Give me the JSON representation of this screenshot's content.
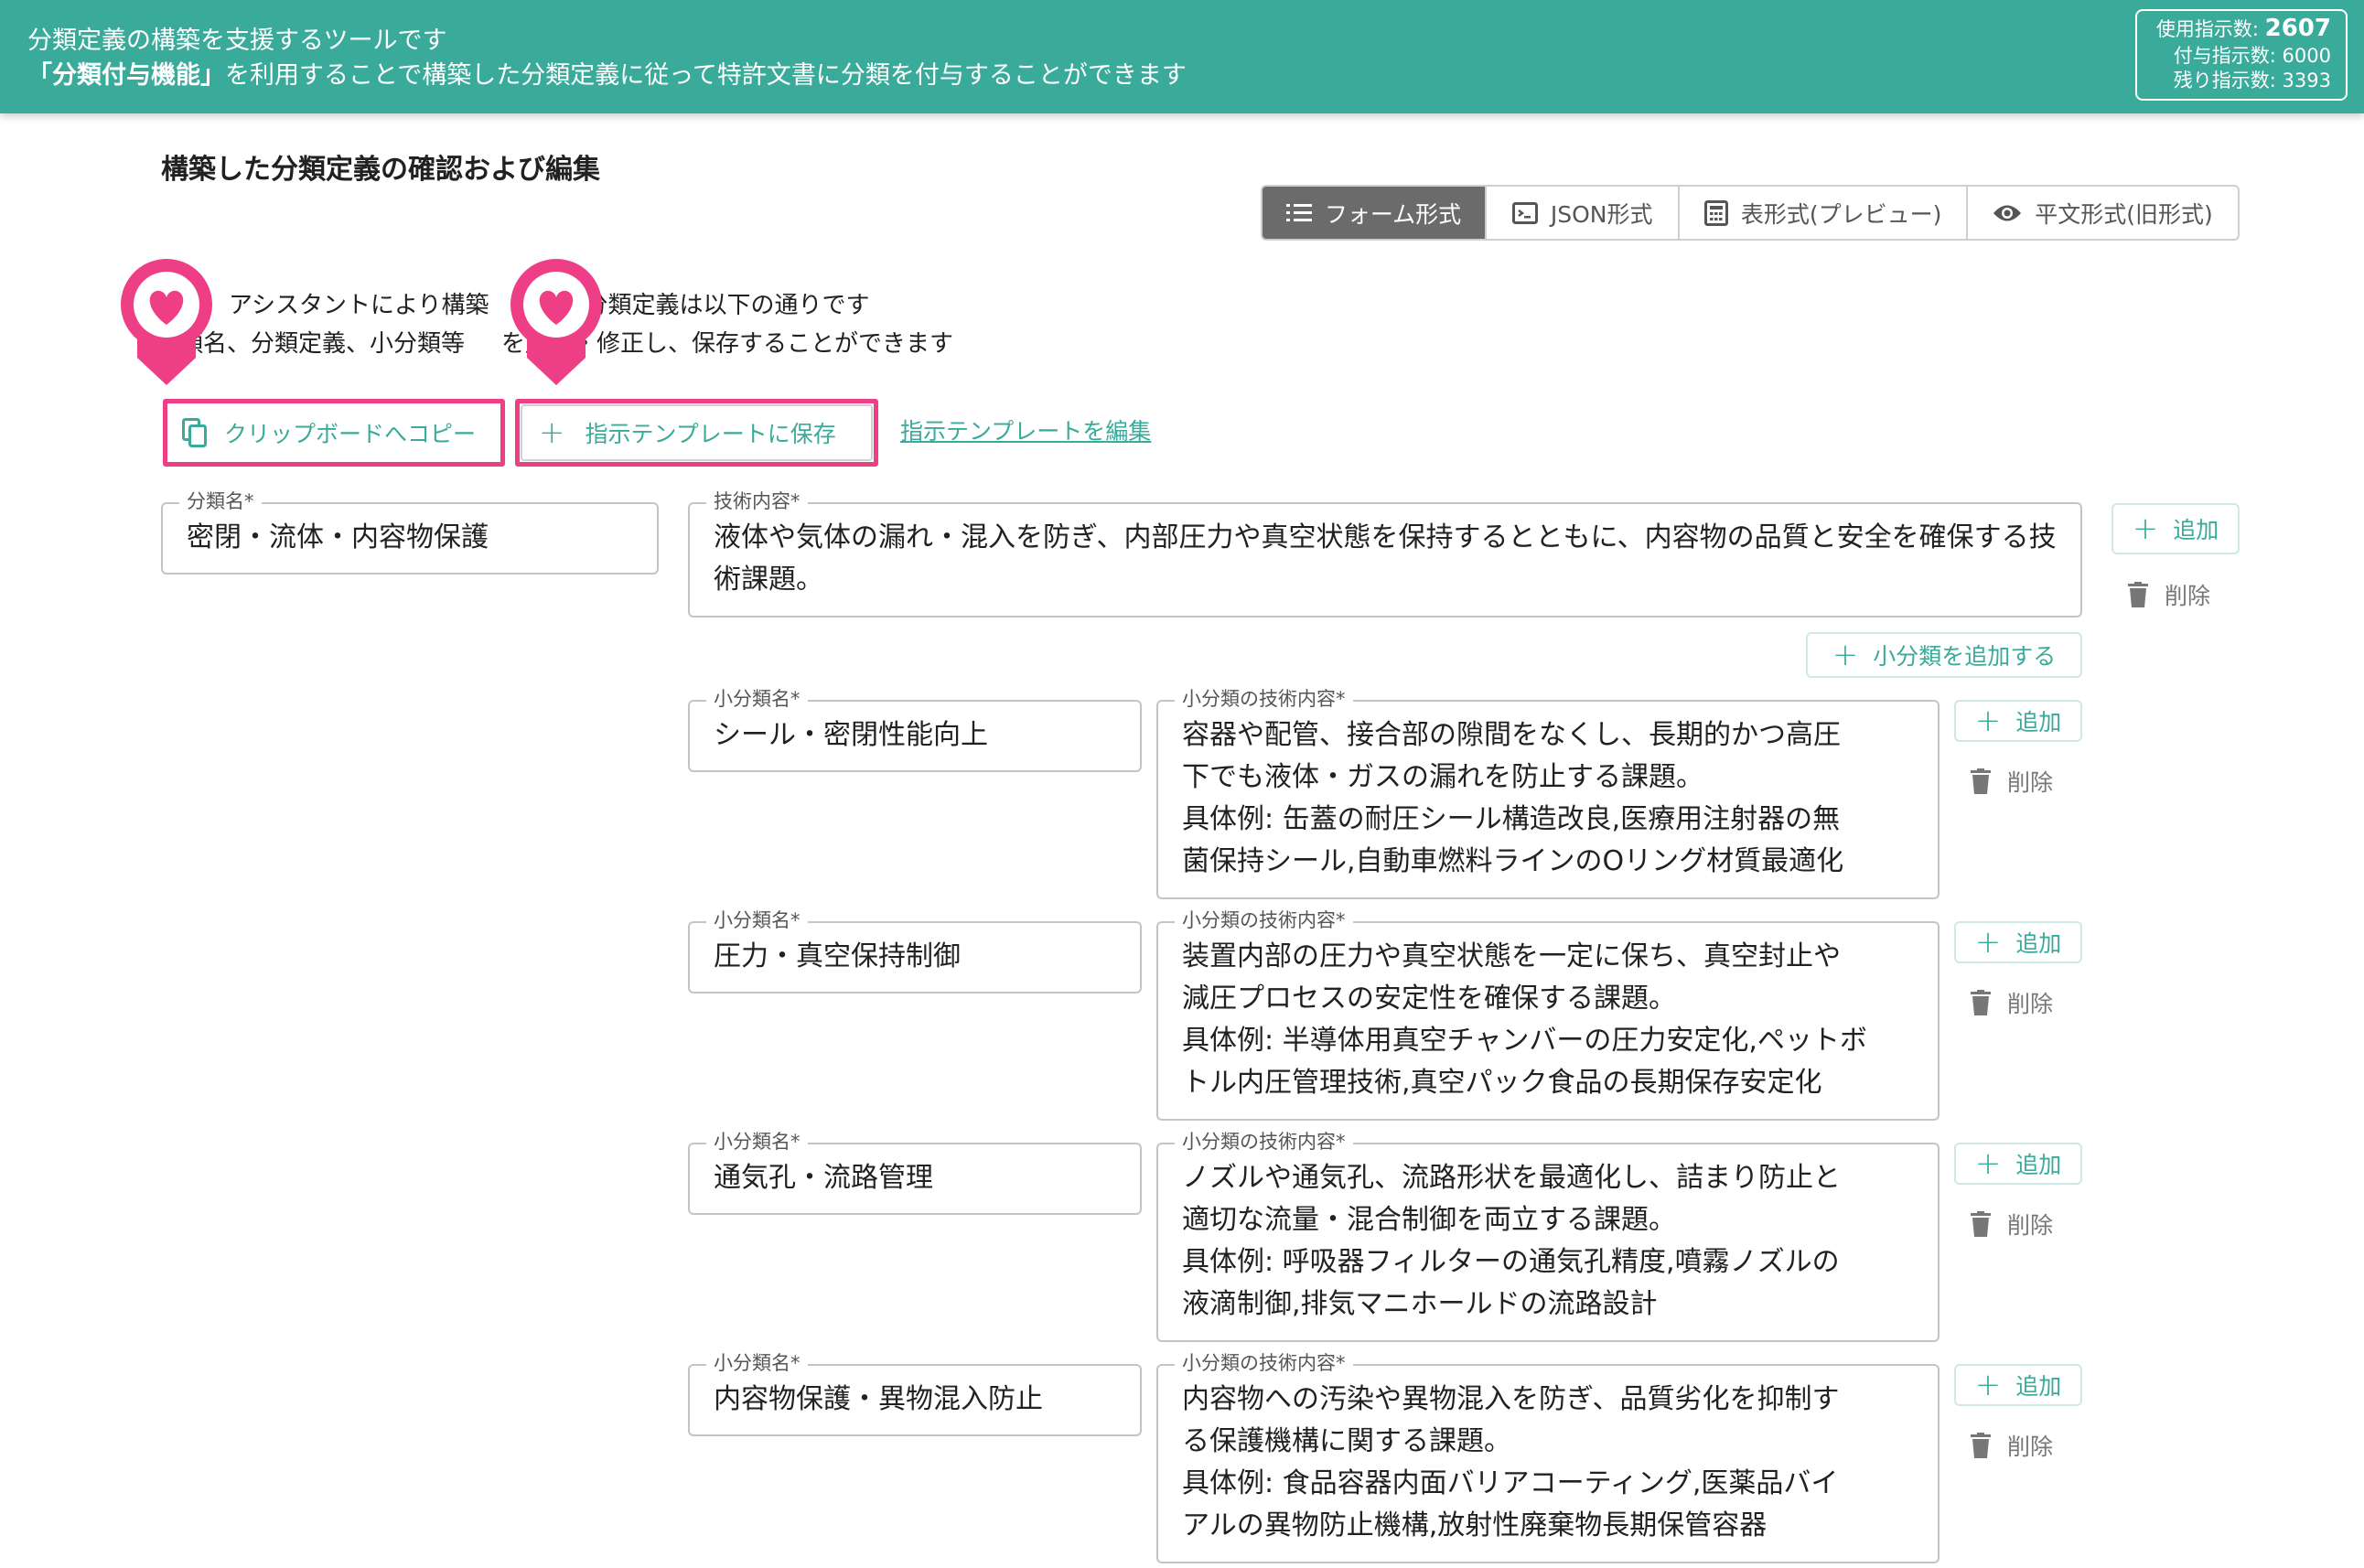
{
  "header": {
    "line1": "分類定義の構築を支援するツールです",
    "line2_bold": "「分類付与機能」",
    "line2_rest": "を利用することで構築した分類定義に従って特許文書に分類を付与することができます",
    "usage_label": "使用指示数:",
    "usage_value": "2607",
    "granted_label": "付与指示数:",
    "granted_value": "6000",
    "remaining_label": "残り指示数:",
    "remaining_value": "3393"
  },
  "page_title": "構築した分類定義の確認および編集",
  "view_toggle": {
    "form": "フォーム形式",
    "json": "JSON形式",
    "table": "表形式(プレビュー)",
    "plain": "平文形式(旧形式)"
  },
  "intro": {
    "line1": "アシスタントにより構築",
    "line1b": "分類定義は以下の通りです",
    "line2": "類名、分類定義、小分類等",
    "line2b": "を加筆・修正し、保存することができます"
  },
  "actions": {
    "copy": "クリップボードへコピー",
    "save_template": "指示テンプレートに保存",
    "edit_template": "指示テンプレートを編集"
  },
  "accent_color": "#3aab9b",
  "highlight_color": "#ee3f86",
  "category": {
    "name_label": "分類名*",
    "name_value": "密閉・流体・内容物保護",
    "tech_label": "技術内容*",
    "tech_value": "液体や気体の漏れ・混入を防ぎ、内部圧力や真空状態を保持するとともに、内容物の品質と安全を確保する技術課題。",
    "add_label": "追加",
    "delete_label": "削除",
    "add_sub_label": "小分類を追加する"
  },
  "subcategories": [
    {
      "name_label": "小分類名*",
      "name_value": "シール・密閉性能向上",
      "tech_label": "小分類の技術内容*",
      "tech_value": "容器や配管、接合部の隙間をなくし、長期的かつ高圧\n下でも液体・ガスの漏れを防止する課題。\n具体例: 缶蓋の耐圧シール構造改良,医療用注射器の無\n菌保持シール,自動車燃料ラインのOリング材質最適化",
      "add_label": "追加",
      "delete_label": "削除"
    },
    {
      "name_label": "小分類名*",
      "name_value": "圧力・真空保持制御",
      "tech_label": "小分類の技術内容*",
      "tech_value": "装置内部の圧力や真空状態を一定に保ち、真空封止や\n減圧プロセスの安定性を確保する課題。\n具体例: 半導体用真空チャンバーの圧力安定化,ペットボ\nトル内圧管理技術,真空パック食品の長期保存安定化",
      "add_label": "追加",
      "delete_label": "削除"
    },
    {
      "name_label": "小分類名*",
      "name_value": "通気孔・流路管理",
      "tech_label": "小分類の技術内容*",
      "tech_value": "ノズルや通気孔、流路形状を最適化し、詰まり防止と\n適切な流量・混合制御を両立する課題。\n具体例: 呼吸器フィルターの通気孔精度,噴霧ノズルの\n液滴制御,排気マニホールドの流路設計",
      "add_label": "追加",
      "delete_label": "削除"
    },
    {
      "name_label": "小分類名*",
      "name_value": "内容物保護・異物混入防止",
      "tech_label": "小分類の技術内容*",
      "tech_value": "内容物への汚染や異物混入を防ぎ、品質劣化を抑制す\nる保護機構に関する課題。\n具体例: 食品容器内面バリアコーティング,医薬品バイ\nアルの異物防止機構,放射性廃棄物長期保管容器",
      "add_label": "追加",
      "delete_label": "削除"
    }
  ]
}
